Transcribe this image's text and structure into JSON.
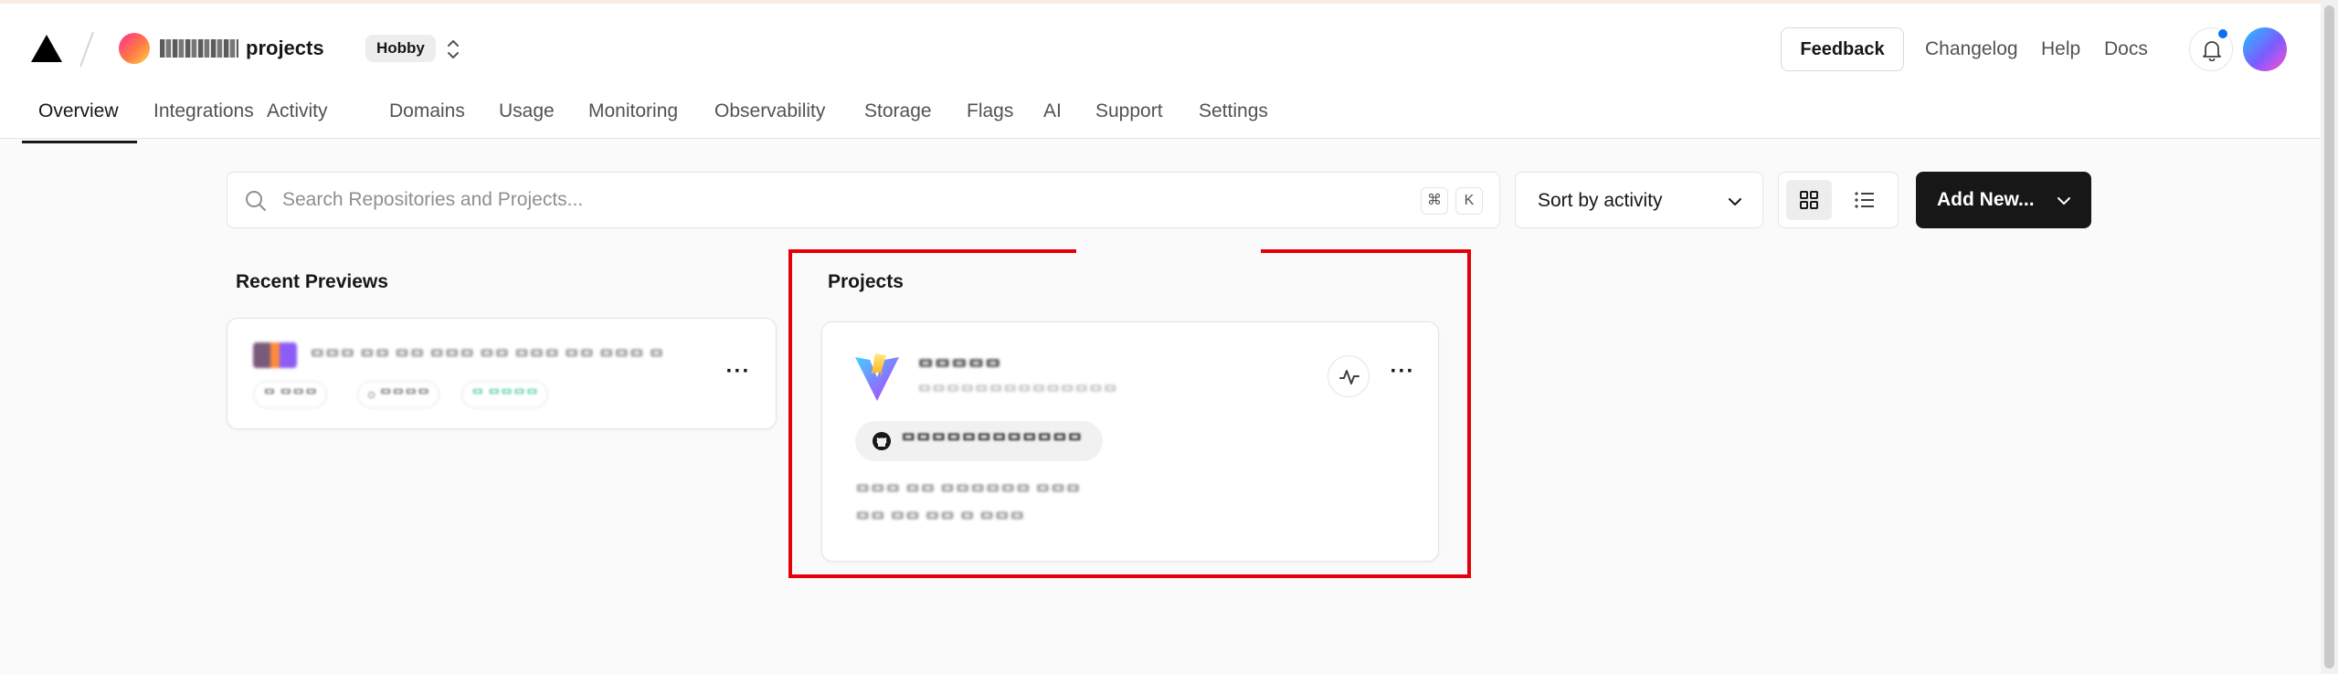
{
  "header": {
    "team_name": "projects",
    "plan": "Hobby",
    "feedback": "Feedback",
    "links": [
      "Changelog",
      "Help",
      "Docs"
    ]
  },
  "tabs": [
    "Overview",
    "Integrations",
    "Activity",
    "Domains",
    "Usage",
    "Monitoring",
    "Observability",
    "Storage",
    "Flags",
    "AI",
    "Support",
    "Settings"
  ],
  "toolbar": {
    "search_placeholder": "Search Repositories and Projects...",
    "kbd_cmd": "⌘",
    "kbd_k": "K",
    "sort_label": "Sort by activity",
    "add_label": "Add New..."
  },
  "recent_previews": {
    "title": "Recent Previews",
    "item": {
      "title": "ᄆᄆᄆ ᄆᄆ ᄆᄆ ᄆᄆᄆ ᄆᄆ ᄆᄆᄆ ᄆᄆ ᄆᄆᄆ ᄆ",
      "chips": [
        "ᄆ ᄆᄆᄆ",
        "○ ᄆᄆᄆᄆ",
        "ᄆ ᄆᄆᄆᄆ"
      ]
    }
  },
  "projects": {
    "title": "Projects",
    "card": {
      "name": "ᄆᄆᄆᄆᄆ",
      "url": "ᄆᄆᄆᄆᄆᄆᄆᄆᄆᄆᄆᄆᄆᄆ",
      "repo": "ᄆᄆᄆᄆᄆᄆᄆᄆᄆᄆᄆᄆ",
      "commit": "ᄆᄆᄆ ᄆᄆ ᄆᄆᄆᄆᄆᄆ ᄆᄆᄆ",
      "meta": "ᄆᄆ ᄆᄆ ᄆᄆ ᄆ ᄆᄆᄆ"
    }
  },
  "colors": {
    "highlight": "#e3000b",
    "primary_button": "#171717",
    "notification": "#0a72ef"
  }
}
